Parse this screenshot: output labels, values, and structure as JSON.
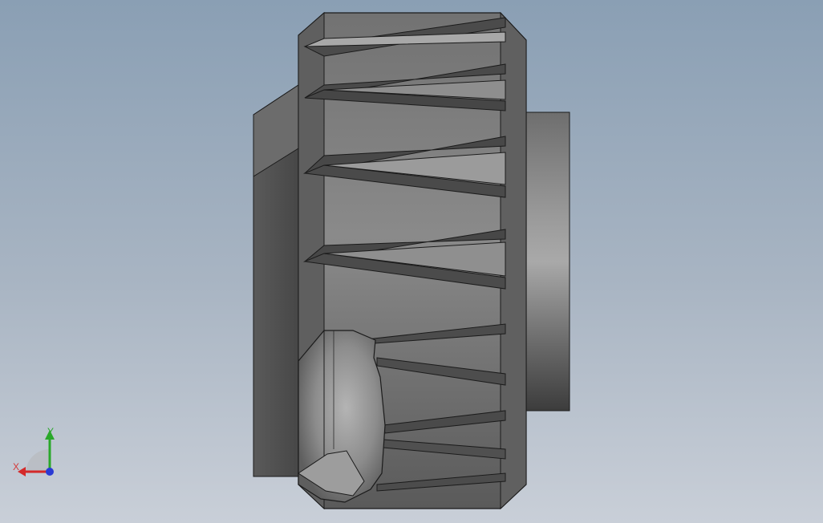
{
  "viewport": {
    "background_top": "#8a9fb4",
    "background_bottom": "#c9cfd8"
  },
  "model": {
    "description_icon": "bevel-gear-3d-model",
    "colors": {
      "tooth_light": "#a7a7a7",
      "tooth_dark": "#4a4a4a",
      "body": "#7d7d7d",
      "hub": "#8f8f8f",
      "edge": "#1b1b1b"
    }
  },
  "triad": {
    "x_label": "X",
    "y_label": "Y",
    "x_color": "#d42a2a",
    "y_color": "#2aa82a",
    "z_color": "#2a3ad4"
  }
}
